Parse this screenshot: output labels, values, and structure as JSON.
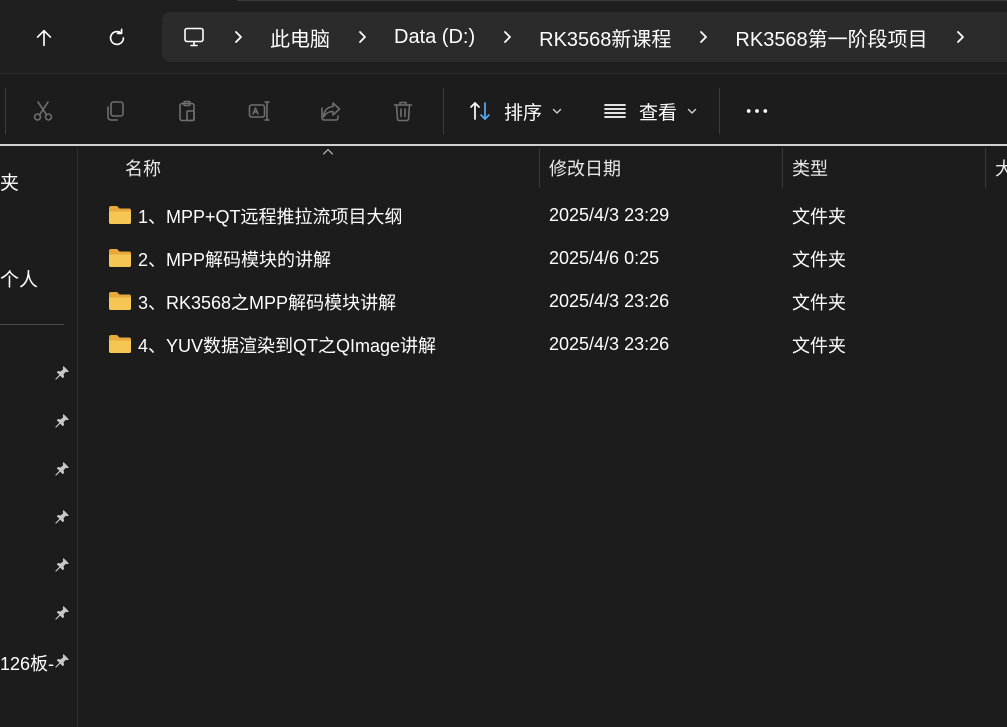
{
  "breadcrumb": {
    "items": [
      "此电脑",
      "Data (D:)",
      "RK3568新课程",
      "RK3568第一阶段项目"
    ]
  },
  "toolbar": {
    "sort_label": "排序",
    "view_label": "查看"
  },
  "navpane": {
    "partial_labels": [
      "夹",
      "个人",
      "126板-"
    ]
  },
  "file_list": {
    "columns": [
      "名称",
      "修改日期",
      "类型",
      "大"
    ],
    "rows": [
      {
        "name": "1、MPP+QT远程推拉流项目大纲",
        "modified": "2025/4/3 23:29",
        "type": "文件夹"
      },
      {
        "name": "2、MPP解码模块的讲解",
        "modified": "2025/4/6 0:25",
        "type": "文件夹"
      },
      {
        "name": "3、RK3568之MPP解码模块讲解",
        "modified": "2025/4/3 23:26",
        "type": "文件夹"
      },
      {
        "name": "4、YUV数据渲染到QT之QImage讲解",
        "modified": "2025/4/3 23:26",
        "type": "文件夹"
      }
    ]
  },
  "colors": {
    "folder": "#f2c14e",
    "accent_blue": "#5aa9f0",
    "background": "#1c1c1c"
  }
}
